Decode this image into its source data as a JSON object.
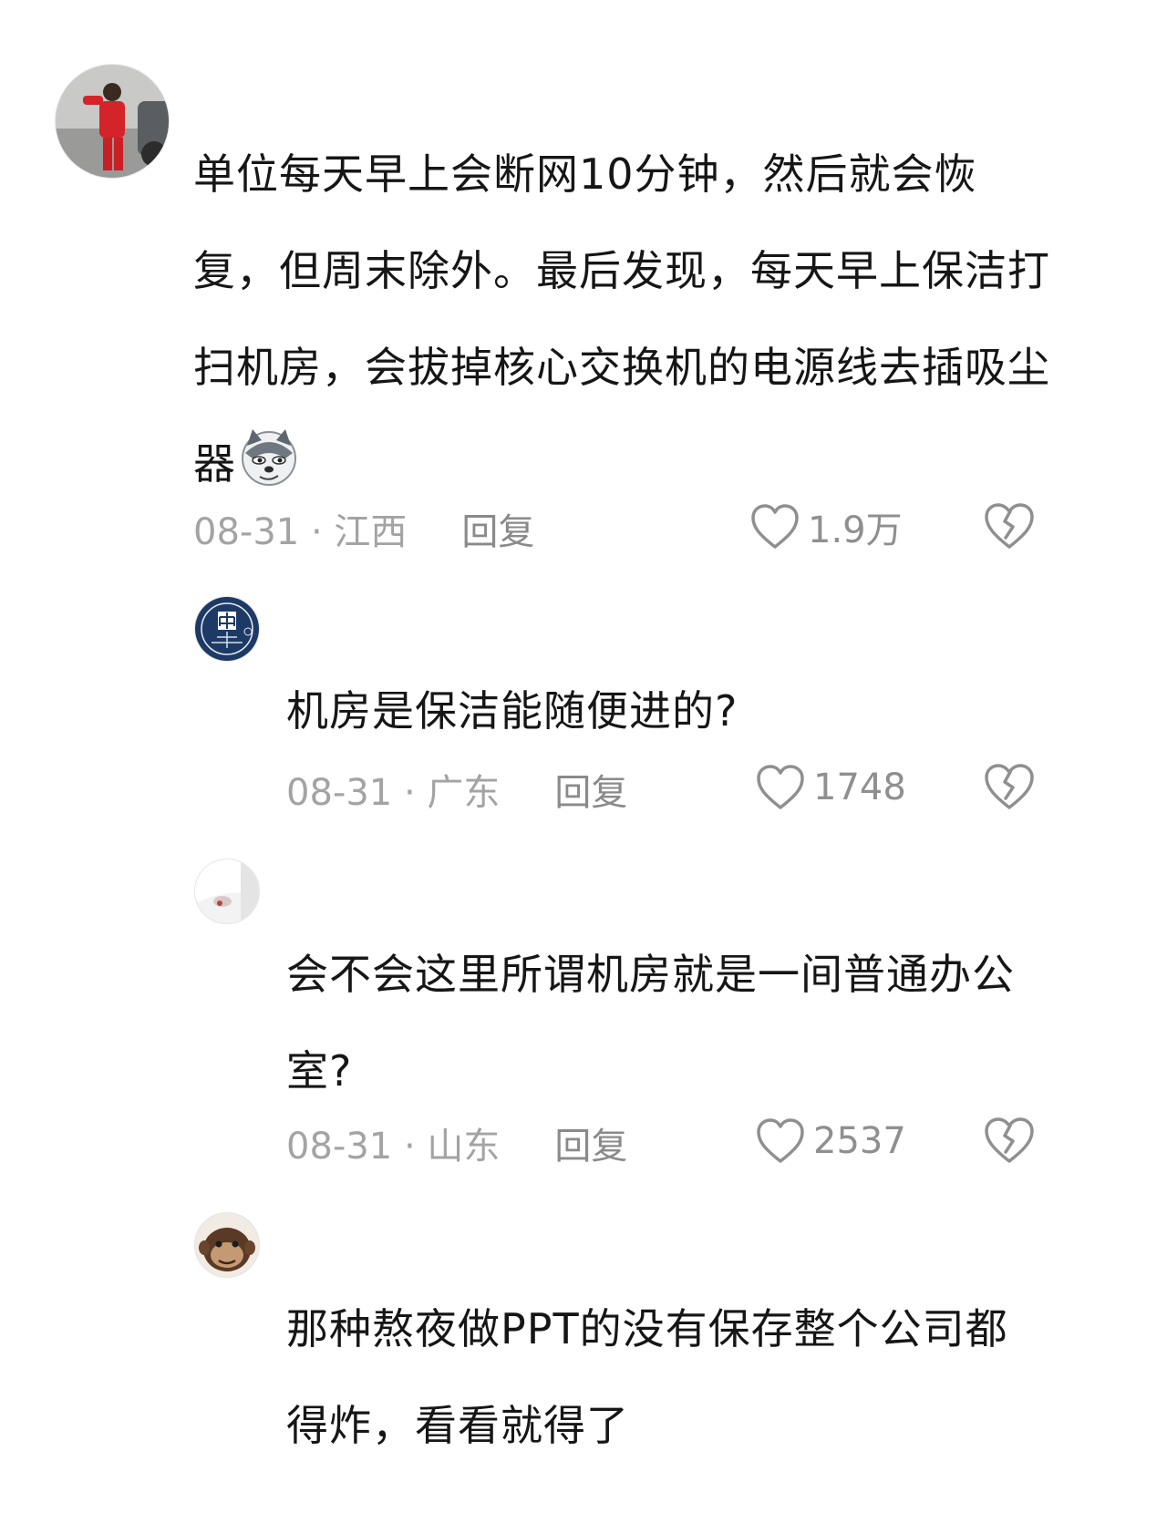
{
  "comments": [
    {
      "avatar_icon": "person-in-red-avatar",
      "text": "单位每天早上会断网10分钟，然后就会恢复，但周末除外。最后发现，每天早上保洁打扫机房，会拔掉核心交换机的电源线去插吸尘器",
      "emoji_icon": "smirking-husky-emoji",
      "date": "08-31",
      "location": "江西",
      "date_location": "08-31 · 江西",
      "reply_label": "回复",
      "like_count": "1.9万"
    },
    {
      "avatar_icon": "blue-seal-avatar",
      "text": "机房是保洁能随便进的?",
      "date": "08-31",
      "location": "广东",
      "date_location": "08-31 · 广东",
      "reply_label": "回复",
      "like_count": "1748"
    },
    {
      "avatar_icon": "white-object-avatar",
      "text": "会不会这里所谓机房就是一间普通办公室?",
      "date": "08-31",
      "location": "山东",
      "date_location": "08-31 · 山东",
      "reply_label": "回复",
      "like_count": "2537"
    },
    {
      "avatar_icon": "monkey-avatar",
      "text": "那种熬夜做PPT的没有保存整个公司都得炸，看看就得了"
    }
  ],
  "colors": {
    "text": "#161616",
    "meta": "#a3a3a3",
    "icon": "#8f8f8f"
  }
}
